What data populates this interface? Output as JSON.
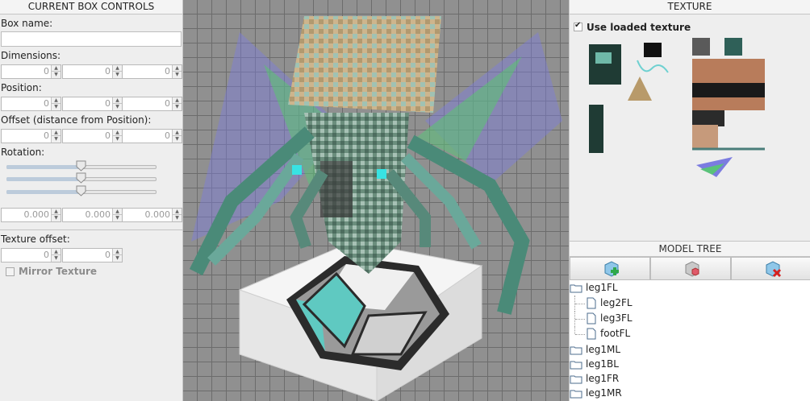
{
  "left_panel": {
    "title": "CURRENT BOX CONTROLS",
    "box_name_label": "Box name:",
    "box_name_value": "",
    "dimensions_label": "Dimensions:",
    "dimensions": [
      "0",
      "0",
      "0"
    ],
    "position_label": "Position:",
    "position": [
      "0",
      "0",
      "0"
    ],
    "offset_label": "Offset (distance from Position):",
    "offset": [
      "0",
      "0",
      "0"
    ],
    "rotation_label": "Rotation:",
    "rotation_slider_levels": [
      0.5,
      0.5,
      0.5
    ],
    "rotation_values": [
      "0.000",
      "0.000",
      "0.000"
    ],
    "texture_offset_label": "Texture offset:",
    "texture_offset": [
      "0",
      "0"
    ],
    "mirror_texture_label": "Mirror Texture"
  },
  "texture_panel": {
    "title": "TEXTURE",
    "use_loaded_label": "Use loaded texture",
    "use_loaded_checked": true
  },
  "model_tree": {
    "title": "MODEL TREE",
    "toolbar_icons": [
      "add-box-icon",
      "add-part-icon",
      "delete-icon"
    ],
    "items": [
      {
        "label": "leg1FL",
        "type": "folder",
        "depth": 0
      },
      {
        "label": "leg2FL",
        "type": "file",
        "depth": 1
      },
      {
        "label": "leg3FL",
        "type": "file",
        "depth": 1
      },
      {
        "label": "footFL",
        "type": "file",
        "depth": 1
      },
      {
        "label": "leg1ML",
        "type": "folder",
        "depth": 0
      },
      {
        "label": "leg1BL",
        "type": "folder",
        "depth": 0
      },
      {
        "label": "leg1FR",
        "type": "folder",
        "depth": 0
      },
      {
        "label": "leg1MR",
        "type": "folder",
        "depth": 0
      }
    ]
  },
  "colors": {
    "accent_teal": "#66c9c4",
    "model_green": "#5a8f7e",
    "wing_blue": "#7b7be0"
  }
}
